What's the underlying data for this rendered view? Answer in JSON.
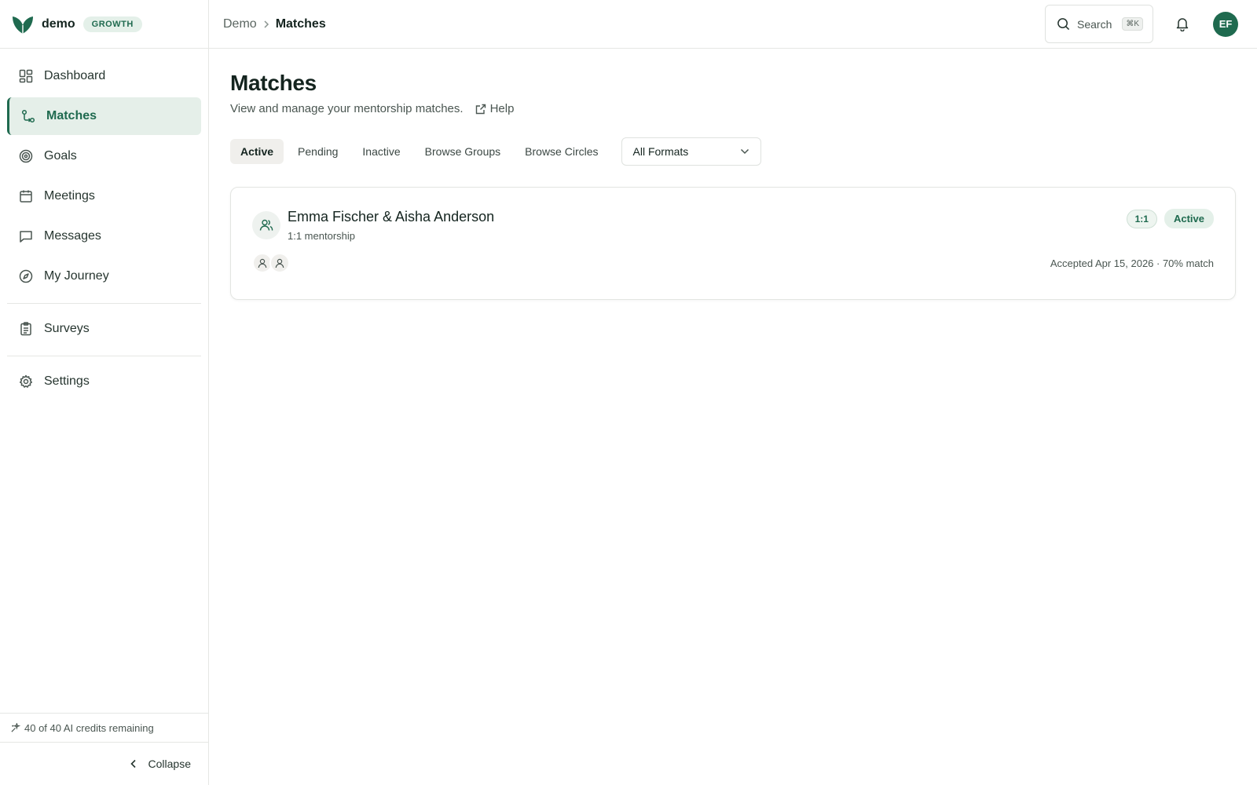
{
  "brand": {
    "name": "demo",
    "plan": "GROWTH",
    "accent_color": "#1f6a4f"
  },
  "sidebar": {
    "items": [
      {
        "label": "Dashboard",
        "icon": "dashboard-icon",
        "active": false
      },
      {
        "label": "Matches",
        "icon": "matches-icon",
        "active": true
      },
      {
        "label": "Goals",
        "icon": "target-icon",
        "active": false
      },
      {
        "label": "Meetings",
        "icon": "calendar-icon",
        "active": false
      },
      {
        "label": "Messages",
        "icon": "message-icon",
        "active": false
      },
      {
        "label": "My Journey",
        "icon": "compass-icon",
        "active": false
      },
      {
        "label": "Surveys",
        "icon": "clipboard-icon",
        "active": false
      },
      {
        "label": "Settings",
        "icon": "gear-icon",
        "active": false
      }
    ],
    "credits_text": "40 of 40 AI credits remaining",
    "collapse_label": "Collapse"
  },
  "header": {
    "breadcrumb": [
      "Demo",
      "Matches"
    ],
    "search_label": "Search",
    "search_shortcut": "⌘K",
    "avatar_initials": "EF"
  },
  "main": {
    "title": "Matches",
    "subtitle": "View and manage your mentorship matches.",
    "help_label": "Help",
    "tabs": [
      {
        "label": "Active",
        "active": true
      },
      {
        "label": "Pending",
        "active": false
      },
      {
        "label": "Inactive",
        "active": false
      },
      {
        "label": "Browse Groups",
        "active": false
      },
      {
        "label": "Browse Circles",
        "active": false
      }
    ],
    "format_filter": {
      "selected": "All Formats"
    },
    "matches": [
      {
        "title": "Emma Fischer & Aisha Anderson",
        "subtitle": "1:1 mentorship",
        "format_badge": "1:1",
        "status_badge": "Active",
        "meta": "Accepted Apr 15, 2026 · 70% match"
      }
    ]
  }
}
